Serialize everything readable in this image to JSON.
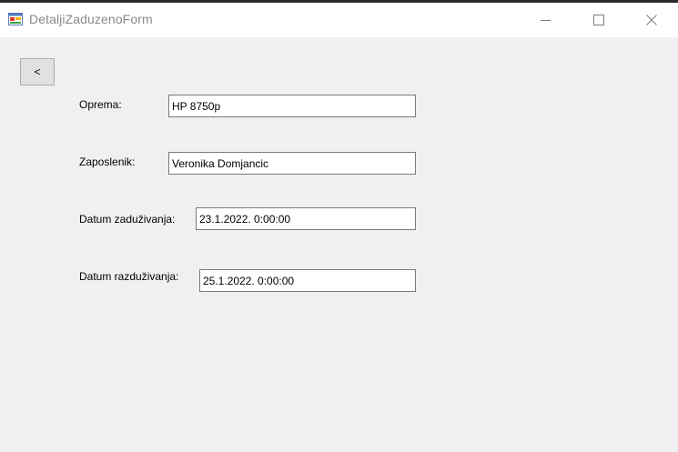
{
  "window": {
    "title": "DetaljiZaduzenoForm"
  },
  "toolbar": {
    "back_label": "<"
  },
  "form": {
    "oprema_label": "Oprema:",
    "oprema_value": "HP 8750p",
    "zaposlenik_label": "Zaposlenik:",
    "zaposlenik_value": "Veronika Domjancic",
    "datum_zaduzivanja_label": "Datum zaduživanja:",
    "datum_zaduzivanja_value": "23.1.2022. 0:00:00",
    "datum_razduzivanja_label": "Datum razduživanja:",
    "datum_razduzivanja_value": "25.1.2022. 0:00:00"
  },
  "icons": {
    "app": "windows-form-icon",
    "minimize": "minimize-icon",
    "maximize": "maximize-icon",
    "close": "close-icon"
  }
}
